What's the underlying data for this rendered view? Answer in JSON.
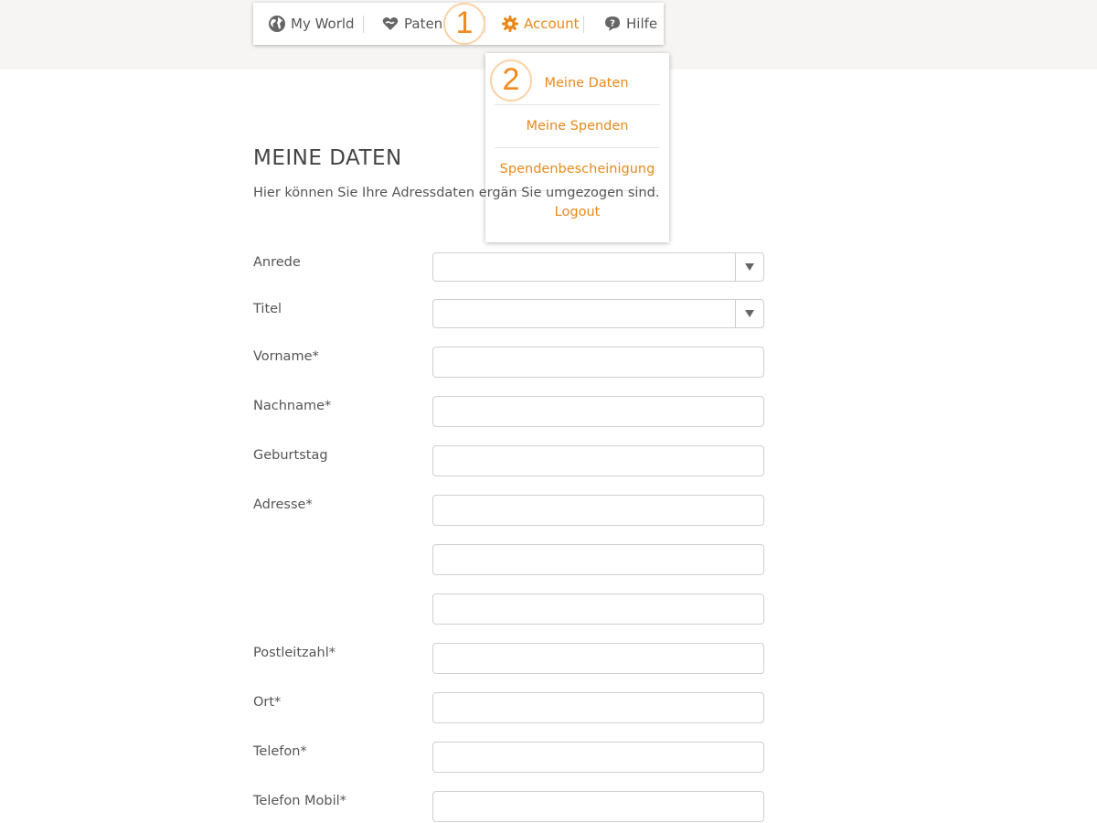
{
  "nav": {
    "items": [
      {
        "label": "My World",
        "icon": "globe-icon"
      },
      {
        "label": "Patenschaft",
        "icon": "heart-hand-icon"
      },
      {
        "label": "Account",
        "icon": "gear-icon",
        "active": true
      },
      {
        "label": "Hilfe",
        "icon": "help-bubble-icon"
      }
    ]
  },
  "steps": {
    "one": "1",
    "two": "2"
  },
  "account_menu": {
    "items": [
      "Meine Daten",
      "Meine Spenden",
      "Spendenbescheinigung",
      "Logout"
    ]
  },
  "page": {
    "title": "MEINE DATEN",
    "intro": "Hier können Sie Ihre Adressdaten ergän                                                          Sie umgezogen sind."
  },
  "form": {
    "anrede": {
      "label": "Anrede",
      "value": ""
    },
    "titel": {
      "label": "Titel",
      "value": ""
    },
    "vorname": {
      "label": "Vorname*",
      "value": ""
    },
    "nachname": {
      "label": "Nachname*",
      "value": ""
    },
    "geburtstag": {
      "label": "Geburtstag",
      "value": ""
    },
    "adresse": {
      "label": "Adresse*",
      "line1": "",
      "line2": "",
      "line3": ""
    },
    "plz": {
      "label": "Postleitzahl*",
      "value": ""
    },
    "ort": {
      "label": "Ort*",
      "value": ""
    },
    "telefon": {
      "label": "Telefon*",
      "value": ""
    },
    "mobil": {
      "label": "Telefon Mobil*",
      "value": ""
    }
  },
  "colors": {
    "accent": "#e8891a",
    "band": "#f6f5f3",
    "text": "#555555"
  }
}
